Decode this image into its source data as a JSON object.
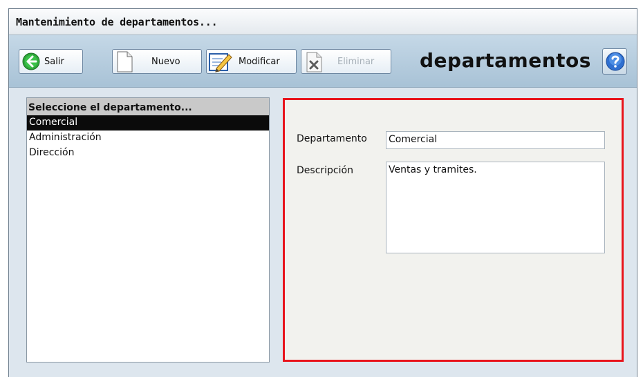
{
  "window": {
    "title": "Mantenimiento de departamentos..."
  },
  "toolbar": {
    "buttons": [
      {
        "label": "Salir",
        "icon": "back-arrow-icon"
      },
      {
        "label": "Nuevo",
        "icon": "new-document-icon"
      },
      {
        "label": "Modificar",
        "icon": "edit-pencil-icon"
      },
      {
        "label": "Eliminar",
        "icon": "delete-document-icon",
        "disabled": true
      }
    ],
    "brand": "departamentos",
    "help_icon": "help-question-icon"
  },
  "list": {
    "header": "Seleccione el departamento...",
    "items": [
      {
        "label": "Comercial",
        "selected": true
      },
      {
        "label": "Administración",
        "selected": false
      },
      {
        "label": "Dirección",
        "selected": false
      }
    ]
  },
  "form": {
    "department_label": "Departamento",
    "department_value": "Comercial",
    "description_label": "Descripción",
    "description_value": "Ventas y tramites."
  },
  "colors": {
    "highlight_border": "#e8141c",
    "selection_bg": "#0b0b0b",
    "toolbar_bg": "#b7cde0",
    "window_bg": "#dde6ee"
  }
}
